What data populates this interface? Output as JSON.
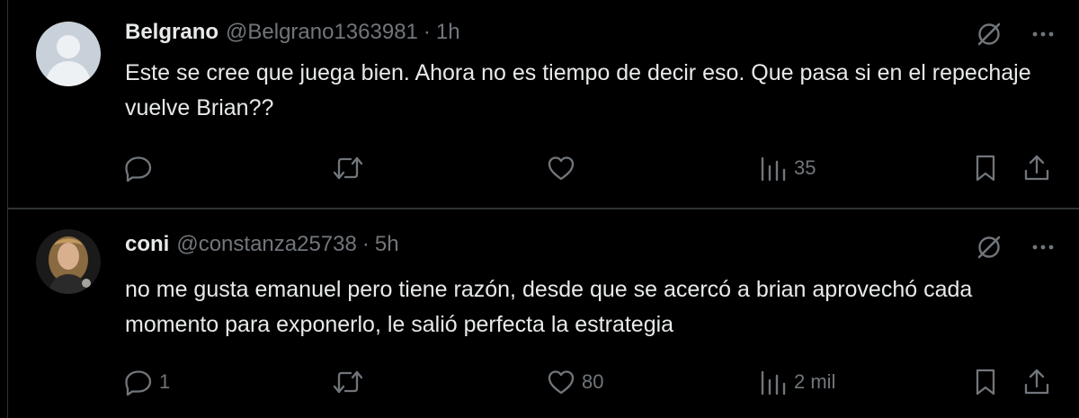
{
  "tweets": [
    {
      "display_name": "Belgrano",
      "handle": "@Belgrano1363981",
      "separator": "·",
      "time": "1h",
      "text": "Este se cree que juega bien. Ahora no es tiempo de decir eso. Que pasa si en el repechaje vuelve Brian??",
      "avatar": "default-avatar",
      "actions": {
        "replies": "",
        "reposts": "",
        "likes": "",
        "views": "35"
      }
    },
    {
      "display_name": "coni",
      "handle": "@constanza25738",
      "separator": "·",
      "time": "5h",
      "text": "no me gusta emanuel pero tiene razón, desde que se acercó a brian aprovechó cada momento para exponerlo, le salió perfecta la estrategia",
      "avatar": "photo-avatar",
      "actions": {
        "replies": "1",
        "reposts": "",
        "likes": "80",
        "views": "2 mil"
      }
    }
  ],
  "icons": [
    "grok-icon",
    "more-icon",
    "reply-icon",
    "repost-icon",
    "like-icon",
    "views-icon",
    "bookmark-icon",
    "share-icon"
  ],
  "colors": {
    "background": "#000000",
    "text_primary": "#e7e9ea",
    "text_secondary": "#71767b",
    "border": "#2f3336"
  }
}
